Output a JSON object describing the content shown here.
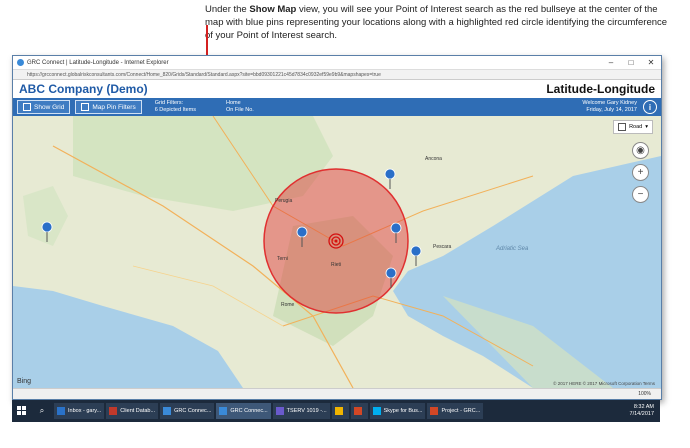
{
  "caption": {
    "pre": "Under the ",
    "bold": "Show Map",
    "post": " view, you will see your Point of Interest search as the red bullseye at the center of the map with blue pins representing your locations along with a highlighted red circle identifying the circumference of your Point of Interest search."
  },
  "browser": {
    "title": "GRC Connect | Latitude-Longitude - Internet Explorer",
    "url": "https://grcconnect.globalriskconsultants.com/Connect/Home_820/Grids/Standard/Standard.aspx?site=bbd09301221c45d7834c0932ef59e9b9&mapshapes=true"
  },
  "header": {
    "company": "ABC Company (Demo)",
    "module": "Latitude-Longitude"
  },
  "toolbar": {
    "show_grid": "Show Grid",
    "map_pin_filters": "Map Pin Filters",
    "grid_filters": "Grid Filters:",
    "depicted": "6 Depicted Items",
    "home": "Home",
    "on_file": "On File No.",
    "welcome": "Welcome Gary Kidney",
    "date": "Friday, July 14, 2017",
    "info": "i"
  },
  "map": {
    "type_label": "Road",
    "sea_label": "Adriatic Sea",
    "city_labels": [
      "Rome",
      "Rieti",
      "Ancona",
      "Perugia",
      "Pescara",
      "Terni"
    ],
    "zoom_in": "+",
    "zoom_out": "−",
    "locate": "◉",
    "bing": "Bing",
    "copyright": "© 2017 HERE © 2017 Microsoft Corporation  Terms"
  },
  "statusbar": {
    "zoom": "100%"
  },
  "taskbar": {
    "items": [
      "Inbox - gary...",
      "Client Datab...",
      "GRC Connec...",
      "GRC Connec...",
      "TSERV 1019 -...",
      "",
      "",
      "Skype for Bus...",
      "Project - GRC..."
    ],
    "time": "8:32 AM",
    "date": "7/14/2017"
  },
  "colors": {
    "accent": "#2f6db5",
    "poi_circle": "#e03030",
    "pin": "#2a6fc8"
  }
}
